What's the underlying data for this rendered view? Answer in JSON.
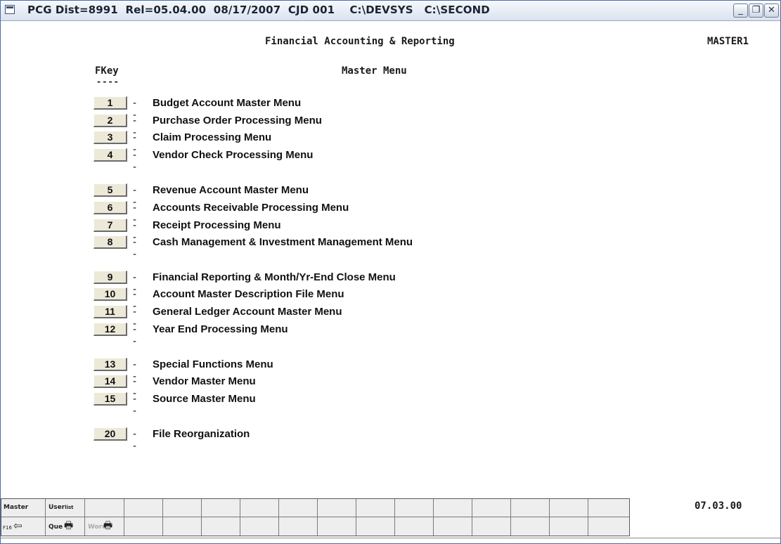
{
  "window": {
    "title": "PCG Dist=8991  Rel=05.04.00  08/17/2007  CJD 001    C:\\DEVSYS   C:\\SECOND",
    "buttons": {
      "minimize": "_",
      "maximize": "❐",
      "close": "✕"
    }
  },
  "header": {
    "app_title": "Financial Accounting & Reporting",
    "screen_id": "MASTER1",
    "fkey_heading": "FKey",
    "fkey_underline": "----",
    "menu_title": "Master Menu"
  },
  "menu": {
    "separator": "--",
    "items": [
      {
        "key": "1",
        "label": "Budget Account Master Menu"
      },
      {
        "key": "2",
        "label": "Purchase Order Processing Menu"
      },
      {
        "key": "3",
        "label": "Claim Processing Menu"
      },
      {
        "key": "4",
        "label": "Vendor Check Processing Menu"
      },
      {
        "key": "5",
        "label": "Revenue Account Master Menu"
      },
      {
        "key": "6",
        "label": "Accounts Receivable Processing Menu"
      },
      {
        "key": "7",
        "label": "Receipt Processing Menu"
      },
      {
        "key": "8",
        "label": "Cash Management & Investment Management Menu"
      },
      {
        "key": "9",
        "label": "Financial Reporting & Month/Yr-End Close Menu"
      },
      {
        "key": "10",
        "label": "Account Master Description File Menu"
      },
      {
        "key": "11",
        "label": "General Ledger Account Master Menu"
      },
      {
        "key": "12",
        "label": "Year End Processing Menu"
      },
      {
        "key": "13",
        "label": "Special Functions Menu"
      },
      {
        "key": "14",
        "label": "Vendor Master Menu"
      },
      {
        "key": "15",
        "label": "Source Master Menu"
      },
      {
        "key": "20",
        "label": "File Reorganization"
      }
    ]
  },
  "toolbar": {
    "master_label": "Master",
    "userlist_label_a": "User",
    "userlist_label_b": "list",
    "f16_label": "F16",
    "que_label": "Que",
    "word_label": "Word",
    "icons": {
      "back": "back-arrow-icon",
      "print": "printer-icon"
    }
  },
  "footer": {
    "version": "07.03.00"
  }
}
